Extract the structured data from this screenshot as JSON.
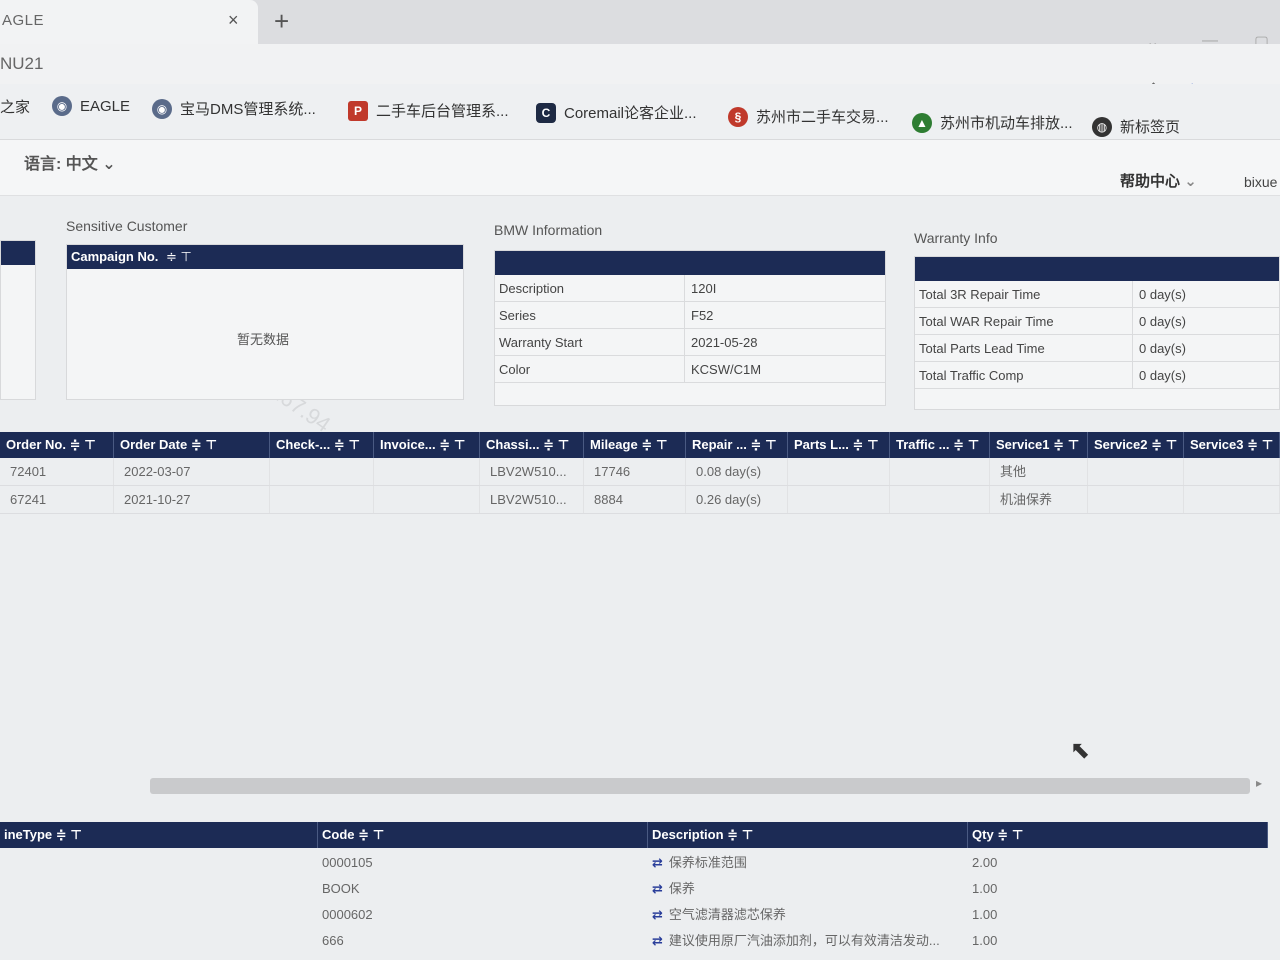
{
  "browser": {
    "tab_title": "AGLE",
    "tab_close": "×",
    "new_tab": "+",
    "url": "NU21",
    "bookmarks": [
      {
        "label": "之家",
        "icon": "home-icon"
      },
      {
        "label": "EAGLE",
        "icon": "bmw-icon"
      },
      {
        "label": "宝马DMS管理系统...",
        "icon": "bmw-icon"
      },
      {
        "label": "二手车后台管理系...",
        "icon": "p-icon"
      },
      {
        "label": "Coremail论客企业...",
        "icon": "coremail-icon"
      },
      {
        "label": "苏州市二手车交易...",
        "icon": "suzhou-icon"
      },
      {
        "label": "苏州市机动车排放...",
        "icon": "car-icon"
      },
      {
        "label": "新标签页",
        "icon": "globe-icon"
      }
    ]
  },
  "header": {
    "language": "语言: 中文",
    "help": "帮助中心",
    "user": "bixue"
  },
  "sensitive_customer": {
    "title": "Sensitive Customer",
    "column": "Campaign No.",
    "empty_text": "暂无数据"
  },
  "bmw_info": {
    "title": "BMW Information",
    "rows": [
      {
        "key": "Description",
        "value": "120I"
      },
      {
        "key": "Series",
        "value": "F52"
      },
      {
        "key": "Warranty Start",
        "value": "2021-05-28"
      },
      {
        "key": "Color",
        "value": "KCSW/C1M"
      }
    ]
  },
  "warranty_info": {
    "title": "Warranty Info",
    "rows": [
      {
        "key": "Total 3R Repair Time",
        "value": "0 day(s)"
      },
      {
        "key": "Total WAR Repair Time",
        "value": "0 day(s)"
      },
      {
        "key": "Total Parts Lead Time",
        "value": "0 day(s)"
      },
      {
        "key": "Total Traffic Comp",
        "value": "0 day(s)"
      }
    ]
  },
  "orders": {
    "columns": [
      "Order No.",
      "Order Date",
      "Check-...",
      "Invoice...",
      "Chassi...",
      "Mileage",
      "Repair ...",
      "Parts L...",
      "Traffic ...",
      "Service1",
      "Service2",
      "Service3"
    ],
    "rows": [
      [
        "72401",
        "2022-03-07",
        "",
        "",
        "LBV2W510...",
        "17746",
        "0.08 day(s)",
        "",
        "",
        "其他",
        "",
        ""
      ],
      [
        "67241",
        "2021-10-27",
        "",
        "",
        "LBV2W510...",
        "8884",
        "0.26 day(s)",
        "",
        "",
        "机油保养",
        "",
        ""
      ]
    ]
  },
  "lines": {
    "columns": [
      "ineType",
      "Code",
      "Description",
      "Qty"
    ],
    "rows": [
      {
        "type": "",
        "code": "0000105",
        "description": "保养标准范围",
        "qty": "2.00"
      },
      {
        "type": "",
        "code": "BOOK",
        "description": "保养",
        "qty": "1.00"
      },
      {
        "type": "",
        "code": "0000602",
        "description": "空气滤清器滤芯保养",
        "qty": "1.00"
      },
      {
        "type": "",
        "code": "666",
        "description": "建议使用原厂汽油添加剂，可以有效清洁发动...",
        "qty": "1.00"
      }
    ]
  },
  "sort_filter_glyph": "≑ ⊤",
  "watermark": "172.18.167.94"
}
